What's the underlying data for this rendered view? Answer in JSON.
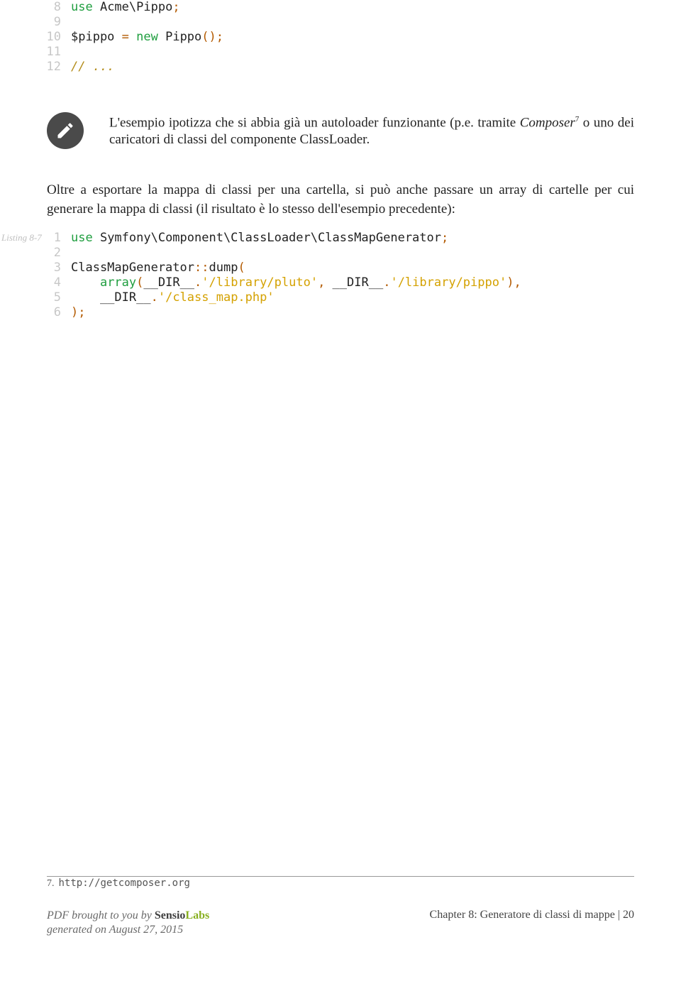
{
  "code_block_1": {
    "lines": [
      {
        "num": "8",
        "tokens": [
          [
            "kw",
            "use"
          ],
          [
            "pl",
            " Acme\\Pippo"
          ],
          [
            "op",
            ";"
          ]
        ]
      },
      {
        "num": "9",
        "tokens": []
      },
      {
        "num": "10",
        "tokens": [
          [
            "var",
            "$pippo "
          ],
          [
            "op",
            "= "
          ],
          [
            "kw",
            "new"
          ],
          [
            "pl",
            " Pippo"
          ],
          [
            "op",
            "();"
          ]
        ]
      },
      {
        "num": "11",
        "tokens": []
      },
      {
        "num": "12",
        "tokens": [
          [
            "cm",
            "// ..."
          ]
        ]
      }
    ]
  },
  "note": {
    "text_before": "L'esempio ipotizza che si abbia già un autoloader funzionante (p.e. tramite ",
    "composer": "Composer",
    "sup": "7",
    "text_after": " o uno dei caricatori di classi del componente ClassLoader."
  },
  "paragraph": "Oltre a esportare la mappa di classi per una cartella, si può anche passare un array di cartelle per cui generare la mappa di classi (il risultato è lo stesso dell'esempio precedente):",
  "listing_label": "Listing 8-7",
  "code_block_2": {
    "lines": [
      {
        "num": "1",
        "tokens": [
          [
            "kw",
            "use"
          ],
          [
            "pl",
            " Symfony\\Component\\ClassLoader\\ClassMapGenerator"
          ],
          [
            "op",
            ";"
          ]
        ]
      },
      {
        "num": "2",
        "tokens": []
      },
      {
        "num": "3",
        "tokens": [
          [
            "cls",
            "ClassMapGenerator"
          ],
          [
            "op",
            "::"
          ],
          [
            "pl",
            "dump"
          ],
          [
            "op",
            "("
          ]
        ]
      },
      {
        "num": "4",
        "tokens": [
          [
            "pl",
            "    "
          ],
          [
            "kw",
            "array"
          ],
          [
            "op",
            "("
          ],
          [
            "pl",
            "__DIR__"
          ],
          [
            "op",
            "."
          ],
          [
            "str",
            "'/library/pluto'"
          ],
          [
            "op",
            ", "
          ],
          [
            "pl",
            "__DIR__"
          ],
          [
            "op",
            "."
          ],
          [
            "str",
            "'/library/pippo'"
          ],
          [
            "op",
            "),"
          ]
        ]
      },
      {
        "num": "5",
        "tokens": [
          [
            "pl",
            "    __DIR__"
          ],
          [
            "op",
            "."
          ],
          [
            "str",
            "'/class_map.php'"
          ]
        ]
      },
      {
        "num": "6",
        "tokens": [
          [
            "op",
            ");"
          ]
        ]
      }
    ]
  },
  "footnote": {
    "num": "7.",
    "url": "http://getcomposer.org"
  },
  "footer": {
    "pdf_line": "PDF brought to you by ",
    "brand_a": "Sensio",
    "brand_b": "Labs",
    "generated": "generated on August 27, 2015",
    "chapter": "Chapter 8: Generatore di classi di mappe | 20"
  }
}
